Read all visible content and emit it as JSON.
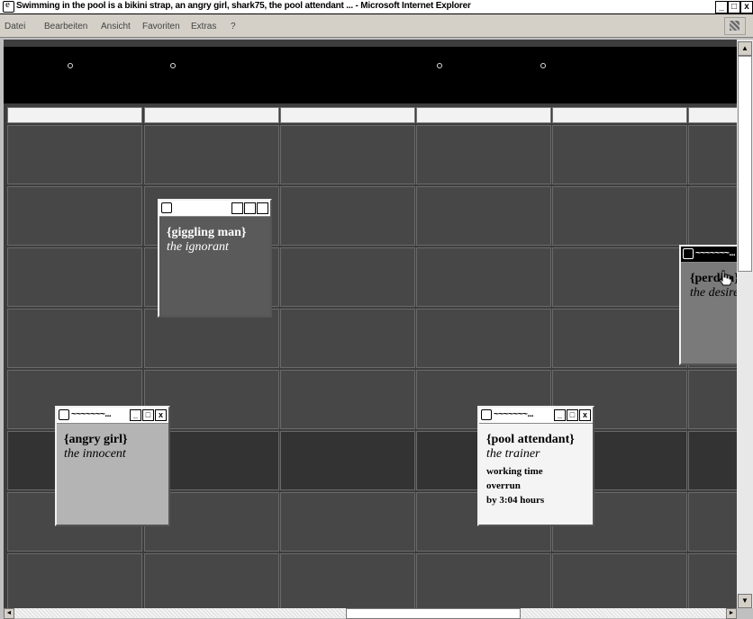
{
  "window": {
    "title": "Swimming in the pool is a bikini strap, an angry girl, shark75, the pool attendant ... - Microsoft Internet Explorer",
    "controls": {
      "minimize": "_",
      "maximize": " ",
      "close": "x"
    }
  },
  "menu": [
    "Datei",
    "Bearbeiten",
    "Ansicht",
    "Favoriten",
    "Extras",
    "?"
  ],
  "popups": [
    {
      "title": "~~~~~~~...",
      "name": "{giggling man}",
      "role": "the ignorant",
      "note": []
    },
    {
      "title": "~~~~~~~...",
      "name": "{angry girl}",
      "role": "the innocent",
      "note": []
    },
    {
      "title": "~~~~~~~...",
      "name": "{pool attendant}",
      "role": "the trainer",
      "note": [
        "working time",
        "overrun",
        "by 3:04 hours"
      ]
    },
    {
      "title": "~~~~~~~...",
      "name": "{perdita}",
      "role": "the desired",
      "note": []
    }
  ],
  "scroll": {
    "up": "▲",
    "down": "▼",
    "left": "◄",
    "right": "►"
  },
  "colors": {
    "background": "#3d3d3d",
    "header_band": "#000000"
  }
}
